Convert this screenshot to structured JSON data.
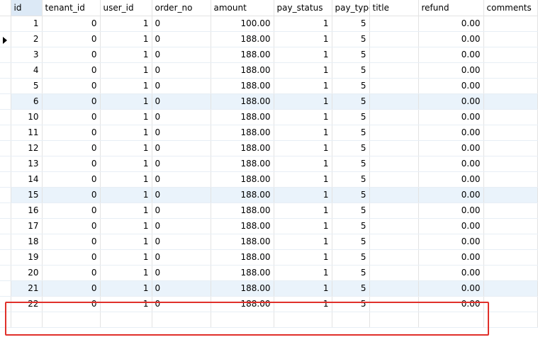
{
  "columns": [
    "id",
    "tenant_id",
    "user_id",
    "order_no",
    "amount",
    "pay_status",
    "pay_type",
    "title",
    "refund",
    "comments"
  ],
  "rows": [
    {
      "id": "1",
      "tenant_id": "0",
      "user_id": "1",
      "order_no": "0",
      "amount": "100.00",
      "pay_status": "1",
      "pay_type": "5",
      "title": "",
      "refund": "0.00",
      "comments": ""
    },
    {
      "id": "2",
      "tenant_id": "0",
      "user_id": "1",
      "order_no": "0",
      "amount": "188.00",
      "pay_status": "1",
      "pay_type": "5",
      "title": "",
      "refund": "0.00",
      "comments": ""
    },
    {
      "id": "3",
      "tenant_id": "0",
      "user_id": "1",
      "order_no": "0",
      "amount": "188.00",
      "pay_status": "1",
      "pay_type": "5",
      "title": "",
      "refund": "0.00",
      "comments": ""
    },
    {
      "id": "4",
      "tenant_id": "0",
      "user_id": "1",
      "order_no": "0",
      "amount": "188.00",
      "pay_status": "1",
      "pay_type": "5",
      "title": "",
      "refund": "0.00",
      "comments": ""
    },
    {
      "id": "5",
      "tenant_id": "0",
      "user_id": "1",
      "order_no": "0",
      "amount": "188.00",
      "pay_status": "1",
      "pay_type": "5",
      "title": "",
      "refund": "0.00",
      "comments": ""
    },
    {
      "id": "6",
      "tenant_id": "0",
      "user_id": "1",
      "order_no": "0",
      "amount": "188.00",
      "pay_status": "1",
      "pay_type": "5",
      "title": "",
      "refund": "0.00",
      "comments": ""
    },
    {
      "id": "10",
      "tenant_id": "0",
      "user_id": "1",
      "order_no": "0",
      "amount": "188.00",
      "pay_status": "1",
      "pay_type": "5",
      "title": "",
      "refund": "0.00",
      "comments": ""
    },
    {
      "id": "11",
      "tenant_id": "0",
      "user_id": "1",
      "order_no": "0",
      "amount": "188.00",
      "pay_status": "1",
      "pay_type": "5",
      "title": "",
      "refund": "0.00",
      "comments": ""
    },
    {
      "id": "12",
      "tenant_id": "0",
      "user_id": "1",
      "order_no": "0",
      "amount": "188.00",
      "pay_status": "1",
      "pay_type": "5",
      "title": "",
      "refund": "0.00",
      "comments": ""
    },
    {
      "id": "13",
      "tenant_id": "0",
      "user_id": "1",
      "order_no": "0",
      "amount": "188.00",
      "pay_status": "1",
      "pay_type": "5",
      "title": "",
      "refund": "0.00",
      "comments": ""
    },
    {
      "id": "14",
      "tenant_id": "0",
      "user_id": "1",
      "order_no": "0",
      "amount": "188.00",
      "pay_status": "1",
      "pay_type": "5",
      "title": "",
      "refund": "0.00",
      "comments": ""
    },
    {
      "id": "15",
      "tenant_id": "0",
      "user_id": "1",
      "order_no": "0",
      "amount": "188.00",
      "pay_status": "1",
      "pay_type": "5",
      "title": "",
      "refund": "0.00",
      "comments": ""
    },
    {
      "id": "16",
      "tenant_id": "0",
      "user_id": "1",
      "order_no": "0",
      "amount": "188.00",
      "pay_status": "1",
      "pay_type": "5",
      "title": "",
      "refund": "0.00",
      "comments": ""
    },
    {
      "id": "17",
      "tenant_id": "0",
      "user_id": "1",
      "order_no": "0",
      "amount": "188.00",
      "pay_status": "1",
      "pay_type": "5",
      "title": "",
      "refund": "0.00",
      "comments": ""
    },
    {
      "id": "18",
      "tenant_id": "0",
      "user_id": "1",
      "order_no": "0",
      "amount": "188.00",
      "pay_status": "1",
      "pay_type": "5",
      "title": "",
      "refund": "0.00",
      "comments": ""
    },
    {
      "id": "19",
      "tenant_id": "0",
      "user_id": "1",
      "order_no": "0",
      "amount": "188.00",
      "pay_status": "1",
      "pay_type": "5",
      "title": "",
      "refund": "0.00",
      "comments": ""
    },
    {
      "id": "20",
      "tenant_id": "0",
      "user_id": "1",
      "order_no": "0",
      "amount": "188.00",
      "pay_status": "1",
      "pay_type": "5",
      "title": "",
      "refund": "0.00",
      "comments": ""
    },
    {
      "id": "21",
      "tenant_id": "0",
      "user_id": "1",
      "order_no": "0",
      "amount": "188.00",
      "pay_status": "1",
      "pay_type": "5",
      "title": "",
      "refund": "0.00",
      "comments": ""
    },
    {
      "id": "22",
      "tenant_id": "0",
      "user_id": "1",
      "order_no": "0",
      "amount": "188.00",
      "pay_status": "1",
      "pay_type": "5",
      "title": "",
      "refund": "0.00",
      "comments": ""
    }
  ],
  "current_row_index": 1,
  "selected_column": "id",
  "highlight_row_indices": [
    5,
    11,
    17
  ],
  "colors": {
    "selected_header_bg": "#dce9f6",
    "alt_row_bg": "#f3f8fd",
    "highlight_row_bg": "#eaf3fb",
    "annotation_border": "#e0302a",
    "grid_line": "#e3e3e3"
  },
  "icons": {
    "current_row_marker": "row-pointer-icon"
  }
}
